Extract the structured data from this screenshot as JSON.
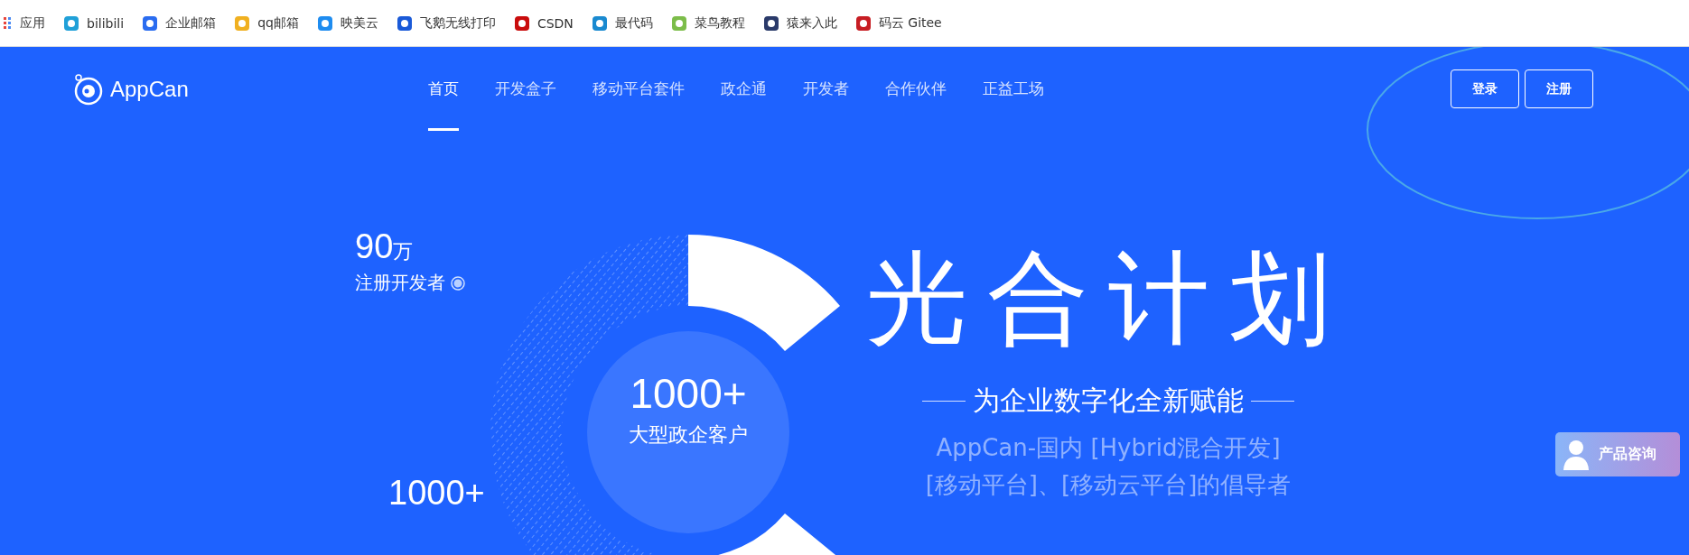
{
  "bookmarks": [
    {
      "label": "应用",
      "kind": "apps",
      "color": "#e8453c"
    },
    {
      "label": "bilibili",
      "kind": "site",
      "color": "#20a0d8"
    },
    {
      "label": "企业邮箱",
      "kind": "site",
      "color": "#2a6cf0"
    },
    {
      "label": "qq邮箱",
      "kind": "site",
      "color": "#f0b020"
    },
    {
      "label": "映美云",
      "kind": "site",
      "color": "#1e8cf0"
    },
    {
      "label": "飞鹅无线打印",
      "kind": "site",
      "color": "#1a5ad8"
    },
    {
      "label": "CSDN",
      "kind": "site",
      "color": "#c90c0c"
    },
    {
      "label": "最代码",
      "kind": "site",
      "color": "#1a8ad0"
    },
    {
      "label": "菜鸟教程",
      "kind": "site",
      "color": "#7cbd4a"
    },
    {
      "label": "猿来入此",
      "kind": "site",
      "color": "#2a3a6a"
    },
    {
      "label": "码云 Gitee",
      "kind": "site",
      "color": "#c71d23"
    }
  ],
  "brand": "AppCan",
  "nav": [
    {
      "label": "首页",
      "selected": true
    },
    {
      "label": "开发盒子",
      "selected": false
    },
    {
      "label": "移动平台套件",
      "selected": false
    },
    {
      "label": "政企通",
      "selected": false
    },
    {
      "label": "开发者",
      "selected": false
    },
    {
      "label": "合作伙伴",
      "selected": false
    },
    {
      "label": "正益工场",
      "selected": false
    }
  ],
  "auth_buttons": [
    "登录",
    "注册"
  ],
  "stats": [
    {
      "value": "90",
      "unit": "万",
      "label": "注册开发者"
    },
    {
      "value": "1000+"
    }
  ],
  "center_stat": {
    "value": "1000+",
    "label": "大型政企客户"
  },
  "hero": {
    "title": "光合计划",
    "subtitle": "为企业数字化全新赋能",
    "description": [
      "AppCan-国内 [Hybrid混合开发]",
      "[移动平台]、[移动云平台]的倡导者"
    ]
  },
  "consult_button": "产品咨询"
}
